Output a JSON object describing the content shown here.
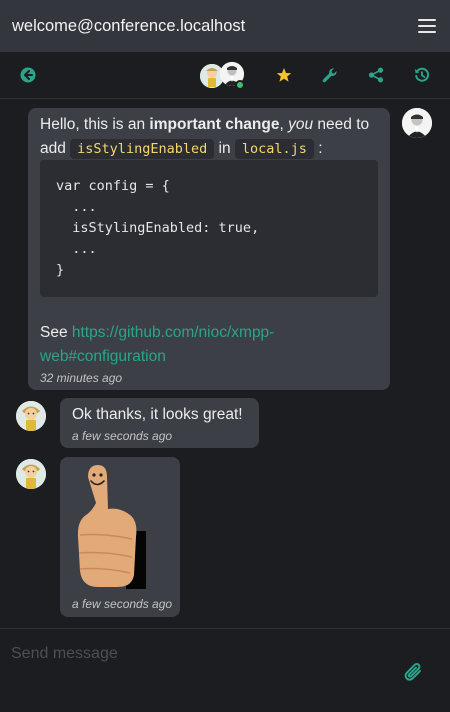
{
  "header": {
    "title": "welcome@conference.localhost"
  },
  "toolbar": {
    "icons": [
      "back-circle-arrow-icon",
      "star-icon",
      "wrench-icon",
      "share-icon",
      "history-icon"
    ],
    "accent_color": "#2aa58a",
    "star_color": "#f2c230"
  },
  "messages": [
    {
      "text_parts": [
        "Hello, this is an ",
        "important change",
        ", ",
        "you",
        " need to add ",
        "isStylingEnabled",
        " in ",
        "local.js",
        " :"
      ],
      "code": "var config = {\n  ...\n  isStylingEnabled: true,\n  ...\n}",
      "see_label": "See ",
      "link_text_line1": "https://github.com/nioc/xmpp-",
      "link_text_line2": "web#configuration",
      "time": "32 minutes ago"
    },
    {
      "text": "Ok thanks, it looks great!",
      "time": "a few seconds ago"
    },
    {
      "image": "thumbs-up-photo",
      "time": "a few seconds ago"
    }
  ],
  "composer": {
    "placeholder": "Send message",
    "attach_icon": "paperclip-icon"
  }
}
